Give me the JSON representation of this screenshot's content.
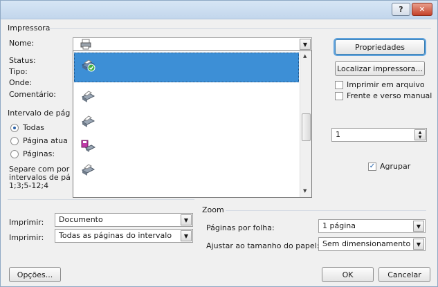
{
  "title_bar": {
    "help": "?",
    "close": "✕"
  },
  "printer": {
    "group_label": "Impressora",
    "name_label": "Nome:",
    "status_label": "Status:",
    "type_label": "Tipo:",
    "where_label": "Onde:",
    "comment_label": "Comentário:",
    "properties_button": "Propriedades",
    "find_printer_button": "Localizar impressora...",
    "print_to_file": "Imprimir em arquivo",
    "manual_duplex": "Frente e verso manual",
    "print_to_file_checked": false,
    "manual_duplex_checked": false
  },
  "page_range": {
    "group_label": "Intervalo de pág",
    "all": "Todas",
    "current": "Página atua",
    "pages": "Páginas:",
    "hint_line1": "Separe com por",
    "hint_line2": "intervalos de pá",
    "hint_line3": "1;3;5-12;4",
    "selected": "Todas"
  },
  "copies": {
    "value": "1",
    "collate_label": "Agrupar",
    "collate_checked": true
  },
  "print_what": {
    "label": "Imprimir:",
    "value": "Documento"
  },
  "print_range": {
    "label": "Imprimir:",
    "value": "Todas as páginas do intervalo"
  },
  "zoom": {
    "group_label": "Zoom",
    "pages_per_sheet_label": "Páginas por folha:",
    "pages_per_sheet_value": "1 página",
    "scale_label": "Ajustar ao tamanho do papel:",
    "scale_value": "Sem dimensionamento"
  },
  "footer": {
    "options_button": "Opções...",
    "ok_button": "OK",
    "cancel_button": "Cancelar"
  },
  "colors": {
    "selection": "#3d8fd6",
    "focus_ring": "#5fa2dd"
  }
}
